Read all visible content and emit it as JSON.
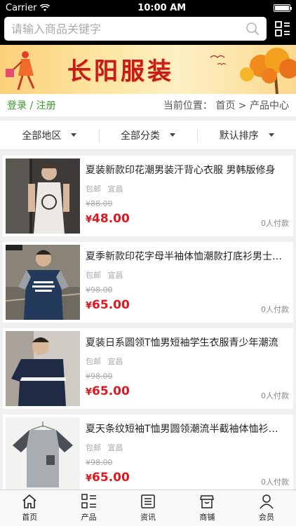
{
  "status": {
    "carrier": "Carrier",
    "time": "10:00 AM"
  },
  "search": {
    "placeholder": "请输入商品关键字"
  },
  "banner": {
    "title": "长阳服装"
  },
  "nav": {
    "login": "登录 / 注册",
    "breadcrumb": "当前位置： 首页 > 产品中心"
  },
  "filters": [
    {
      "label": "全部地区"
    },
    {
      "label": "全部分类"
    },
    {
      "label": "默认排序"
    }
  ],
  "products": [
    {
      "name": "夏装新款印花潮男装汗背心衣服 男韩版修身",
      "shipping": "包邮",
      "location": "宜昌",
      "old_price": "¥88.00",
      "currency": "¥",
      "price": "48.00",
      "paid": "0人付款"
    },
    {
      "name": "夏季新款印花字母半袖体恤潮款打底衫男士韩版",
      "shipping": "包邮",
      "location": "宜昌",
      "old_price": "¥98.00",
      "currency": "¥",
      "price": "65.00",
      "paid": "0人付款"
    },
    {
      "name": "夏装日系圆领T恤男短袖学生衣服青少年潮流",
      "shipping": "包邮",
      "location": "宜昌",
      "old_price": "¥98.00",
      "currency": "¥",
      "price": "65.00",
      "paid": "0人付款"
    },
    {
      "name": "夏天条纹短袖T恤男圆领潮流半截袖体恤衫休闲",
      "shipping": "包邮",
      "location": "宜昌",
      "old_price": "¥98.00",
      "currency": "¥",
      "price": "65.00",
      "paid": "0人付款"
    }
  ],
  "tabs": [
    {
      "label": "首页",
      "icon": "home-icon"
    },
    {
      "label": "产品",
      "icon": "grid-list-icon"
    },
    {
      "label": "资讯",
      "icon": "news-icon"
    },
    {
      "label": "商铺",
      "icon": "shop-icon"
    },
    {
      "label": "会员",
      "icon": "user-icon"
    }
  ],
  "colors": {
    "accent_green": "#3a9a2b",
    "price_red": "#e0181e",
    "banner_red": "#c8191d"
  }
}
